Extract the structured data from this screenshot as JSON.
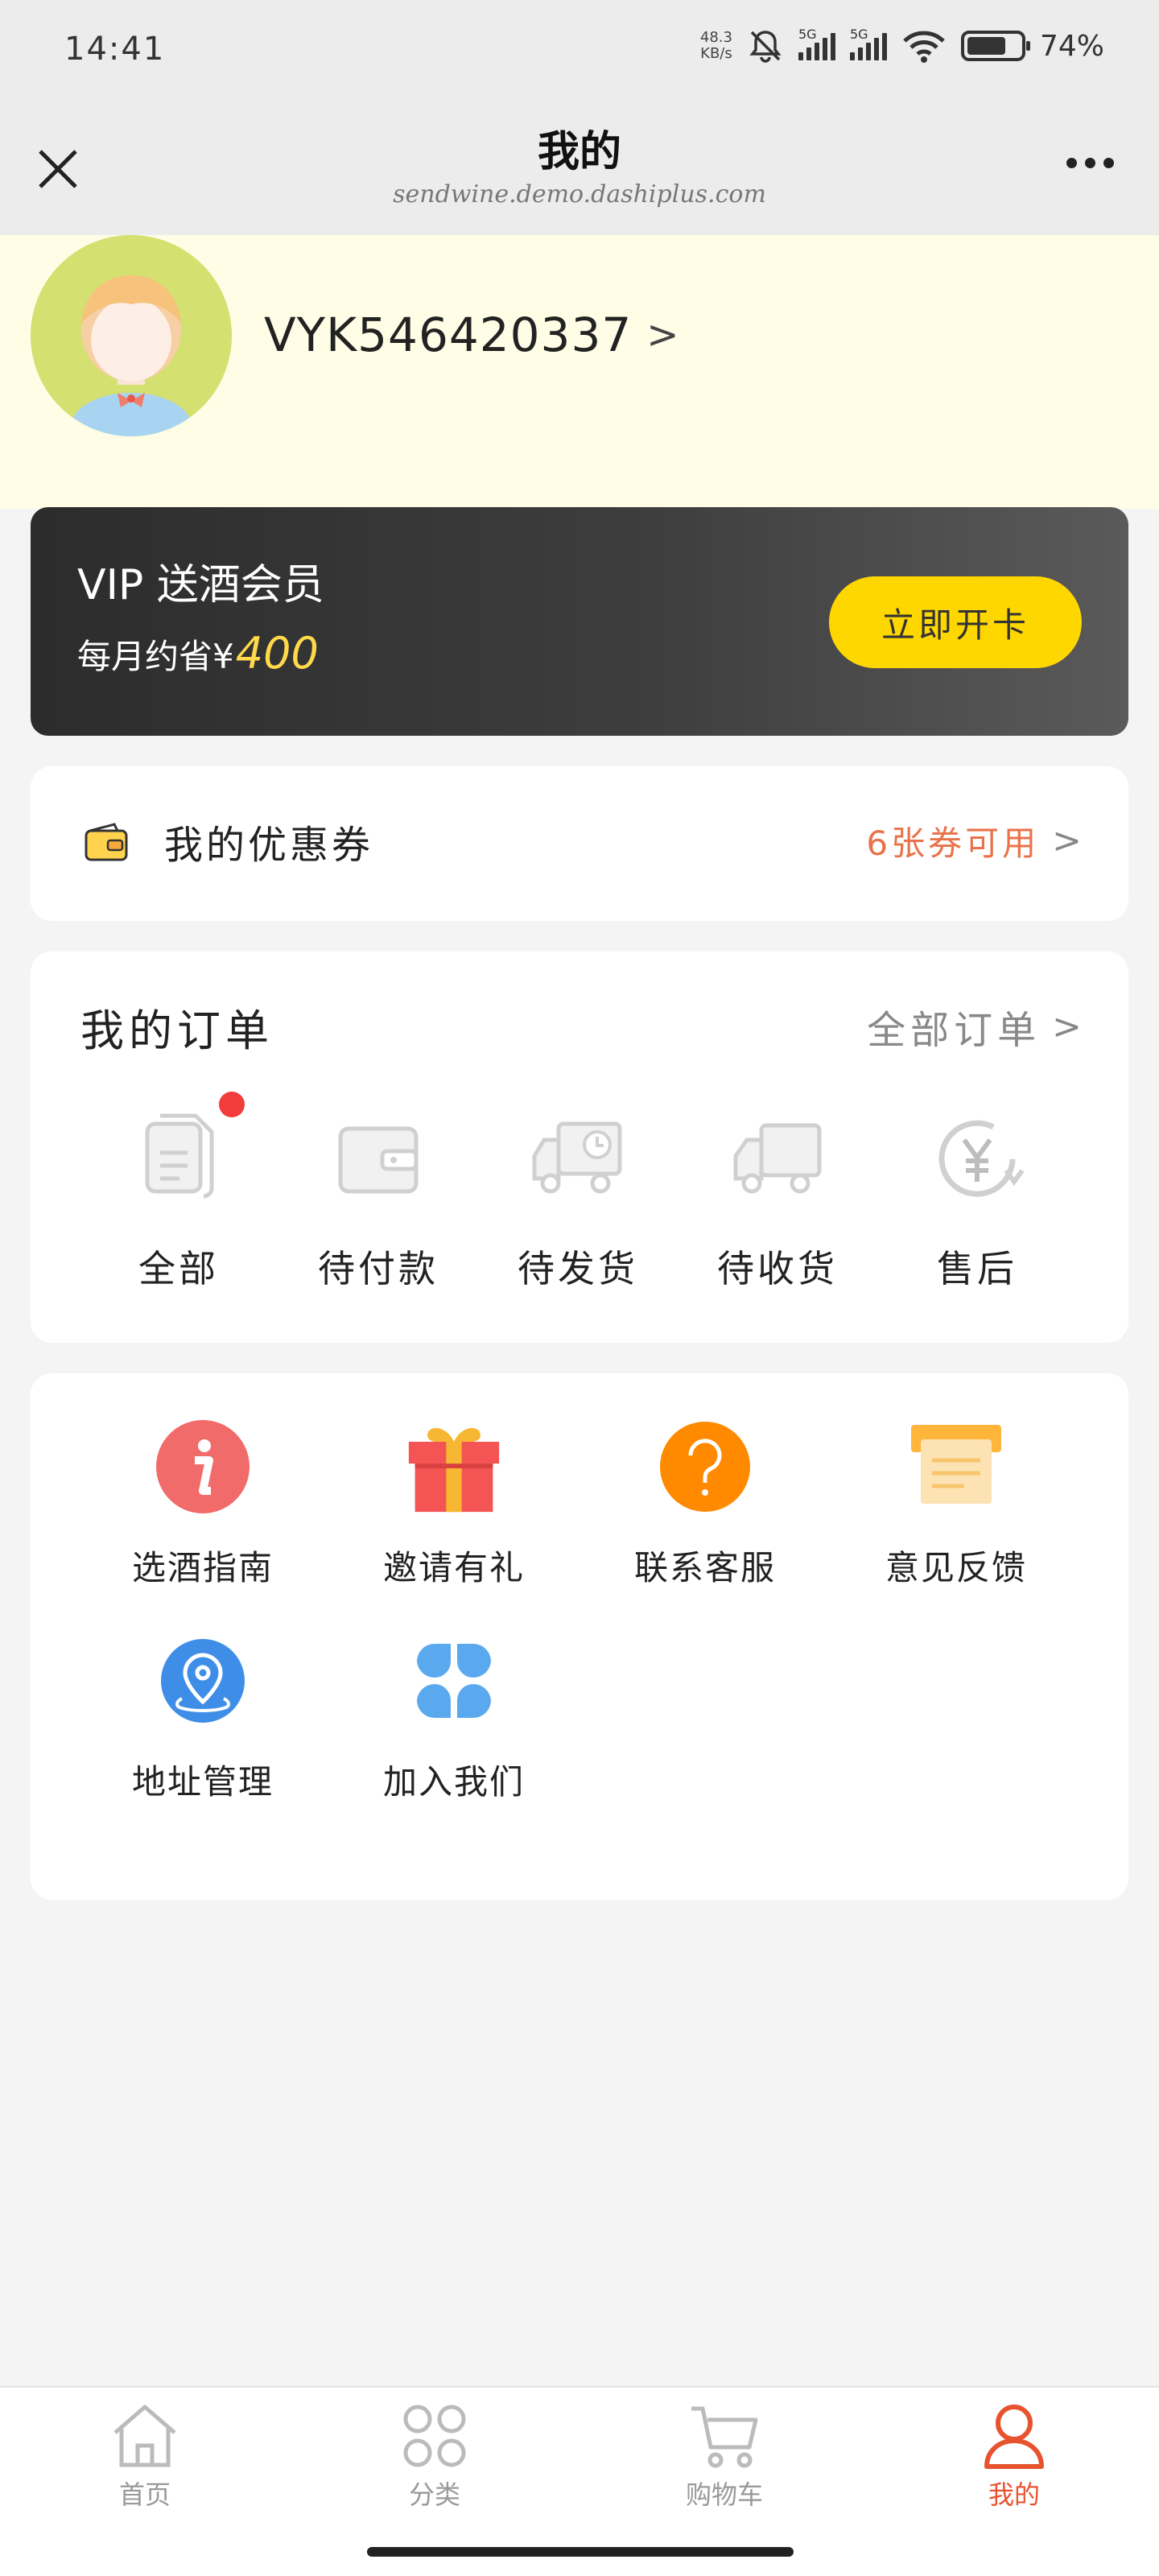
{
  "status_bar": {
    "time": "14:41",
    "net_speed_value": "48.3",
    "net_speed_unit": "KB/s",
    "signal_1_label": "5G",
    "signal_2_label": "5G",
    "battery_percent": "74%",
    "battery_level": 0.74
  },
  "header": {
    "title": "我的",
    "url": "sendwine.demo.dashiplus.com"
  },
  "profile": {
    "username": "VYK546420337",
    "chevron": ">"
  },
  "vip": {
    "title": "VIP 送酒会员",
    "subtitle_prefix": "每月约省¥",
    "amount": "400",
    "button_label": "立即开卡",
    "accent_color": "#ffd700"
  },
  "coupon": {
    "label": "我的优惠券",
    "available": "6张券可用",
    "chevron": ">",
    "accent_color": "#e8734a"
  },
  "orders": {
    "title": "我的订单",
    "all_link": "全部订单",
    "chevron": ">",
    "items": [
      {
        "label": "全部",
        "icon": "document-icon",
        "has_dot": true
      },
      {
        "label": "待付款",
        "icon": "wallet-icon"
      },
      {
        "label": "待发货",
        "icon": "truck-clock-icon"
      },
      {
        "label": "待收货",
        "icon": "truck-icon"
      },
      {
        "label": "售后",
        "icon": "yen-refresh-icon"
      }
    ]
  },
  "services": {
    "items": [
      {
        "label": "选酒指南",
        "icon": "info-icon",
        "color": "#f26b6b"
      },
      {
        "label": "邀请有礼",
        "icon": "gift-icon",
        "color": "#f55454"
      },
      {
        "label": "联系客服",
        "icon": "question-icon",
        "color": "#ff8a00"
      },
      {
        "label": "意见反馈",
        "icon": "feedback-icon",
        "color": "#ffb43a"
      },
      {
        "label": "地址管理",
        "icon": "location-icon",
        "color": "#3e8ee8"
      },
      {
        "label": "加入我们",
        "icon": "grid-icon",
        "color": "#5aa9ef"
      }
    ]
  },
  "tabbar": {
    "items": [
      {
        "label": "首页",
        "icon": "home-icon",
        "active": false
      },
      {
        "label": "分类",
        "icon": "category-icon",
        "active": false
      },
      {
        "label": "购物车",
        "icon": "cart-icon",
        "active": false
      },
      {
        "label": "我的",
        "icon": "user-icon",
        "active": true
      }
    ],
    "active_color": "#e8532f"
  }
}
